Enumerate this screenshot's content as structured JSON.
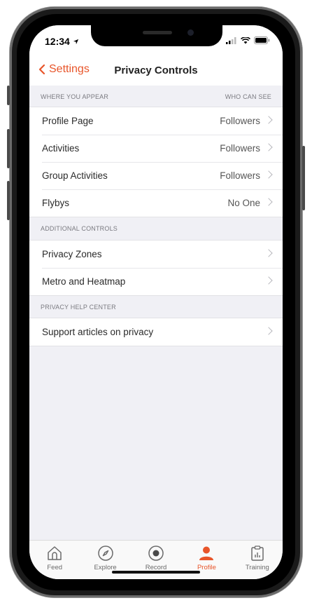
{
  "status_bar": {
    "time": "12:34",
    "location_icon": "location-arrow-icon",
    "signal_icon": "cellular-signal-icon",
    "wifi_icon": "wifi-icon",
    "battery_icon": "battery-icon"
  },
  "nav": {
    "back_label": "Settings",
    "title": "Privacy Controls",
    "accent": "#e8552a"
  },
  "sections": [
    {
      "header": "WHERE YOU APPEAR",
      "header_right": "WHO CAN SEE",
      "rows": [
        {
          "label": "Profile Page",
          "value": "Followers"
        },
        {
          "label": "Activities",
          "value": "Followers"
        },
        {
          "label": "Group Activities",
          "value": "Followers"
        },
        {
          "label": "Flybys",
          "value": "No One"
        }
      ]
    },
    {
      "header": "ADDITIONAL CONTROLS",
      "rows": [
        {
          "label": "Privacy Zones"
        },
        {
          "label": "Metro and Heatmap"
        }
      ]
    },
    {
      "header": "PRIVACY HELP CENTER",
      "rows": [
        {
          "label": "Support articles on privacy"
        }
      ]
    }
  ],
  "tabbar": {
    "active": "Profile",
    "tabs": [
      {
        "label": "Feed",
        "icon": "home-icon"
      },
      {
        "label": "Explore",
        "icon": "compass-icon"
      },
      {
        "label": "Record",
        "icon": "record-icon"
      },
      {
        "label": "Profile",
        "icon": "profile-icon"
      },
      {
        "label": "Training",
        "icon": "clipboard-chart-icon"
      }
    ]
  }
}
